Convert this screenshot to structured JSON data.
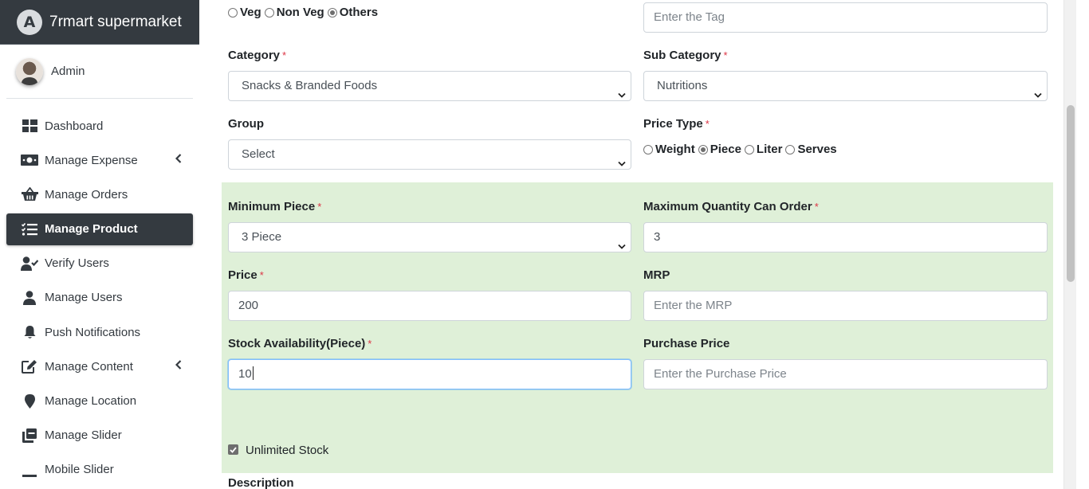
{
  "brand": {
    "logo_letter": "A",
    "name": "7rmart supermarket"
  },
  "user": {
    "name": "Admin"
  },
  "sidebar": {
    "items": [
      {
        "label": "Dashboard",
        "icon": "dashboard-icon"
      },
      {
        "label": "Manage Expense",
        "icon": "money-icon"
      },
      {
        "label": "Manage Orders",
        "icon": "basket-icon"
      },
      {
        "label": "Manage Product",
        "icon": "list-check-icon"
      },
      {
        "label": "Verify Users",
        "icon": "user-check-icon"
      },
      {
        "label": "Manage Users",
        "icon": "user-icon"
      },
      {
        "label": "Push Notifications",
        "icon": "bell-icon"
      },
      {
        "label": "Manage Content",
        "icon": "edit-icon"
      },
      {
        "label": "Manage Location",
        "icon": "map-marker-icon"
      },
      {
        "label": "Manage Slider",
        "icon": "clone-icon"
      },
      {
        "label": "Mobile Slider",
        "icon": "minus-icon"
      }
    ]
  },
  "form": {
    "food_type": {
      "options": [
        "Veg",
        "Non Veg",
        "Others"
      ],
      "selected": "Others"
    },
    "tag": {
      "placeholder": "Enter the Tag"
    },
    "category": {
      "label": "Category",
      "value": "Snacks & Branded Foods"
    },
    "sub_category": {
      "label": "Sub Category",
      "value": "Nutritions"
    },
    "group": {
      "label": "Group",
      "value": "Select"
    },
    "price_type": {
      "label": "Price Type",
      "options": [
        "Weight",
        "Piece",
        "Liter",
        "Serves"
      ],
      "selected": "Piece"
    },
    "minimum_piece": {
      "label": "Minimum Piece",
      "value": "3 Piece"
    },
    "max_quantity": {
      "label": "Maximum Quantity Can Order",
      "value": "3"
    },
    "price": {
      "label": "Price",
      "value": "200"
    },
    "mrp": {
      "label": "MRP",
      "placeholder": "Enter the MRP"
    },
    "stock": {
      "label": "Stock Availability(Piece)",
      "value": "10"
    },
    "purchase_price": {
      "label": "Purchase Price",
      "placeholder": "Enter the Purchase Price"
    },
    "unlimited_stock": {
      "label": "Unlimited Stock",
      "checked": true
    },
    "description": {
      "label": "Description"
    },
    "required_mark": "*"
  },
  "colors": {
    "sidebar_dark": "#343a40",
    "panel_green": "#dff0d8",
    "required_red": "#dc3545"
  }
}
